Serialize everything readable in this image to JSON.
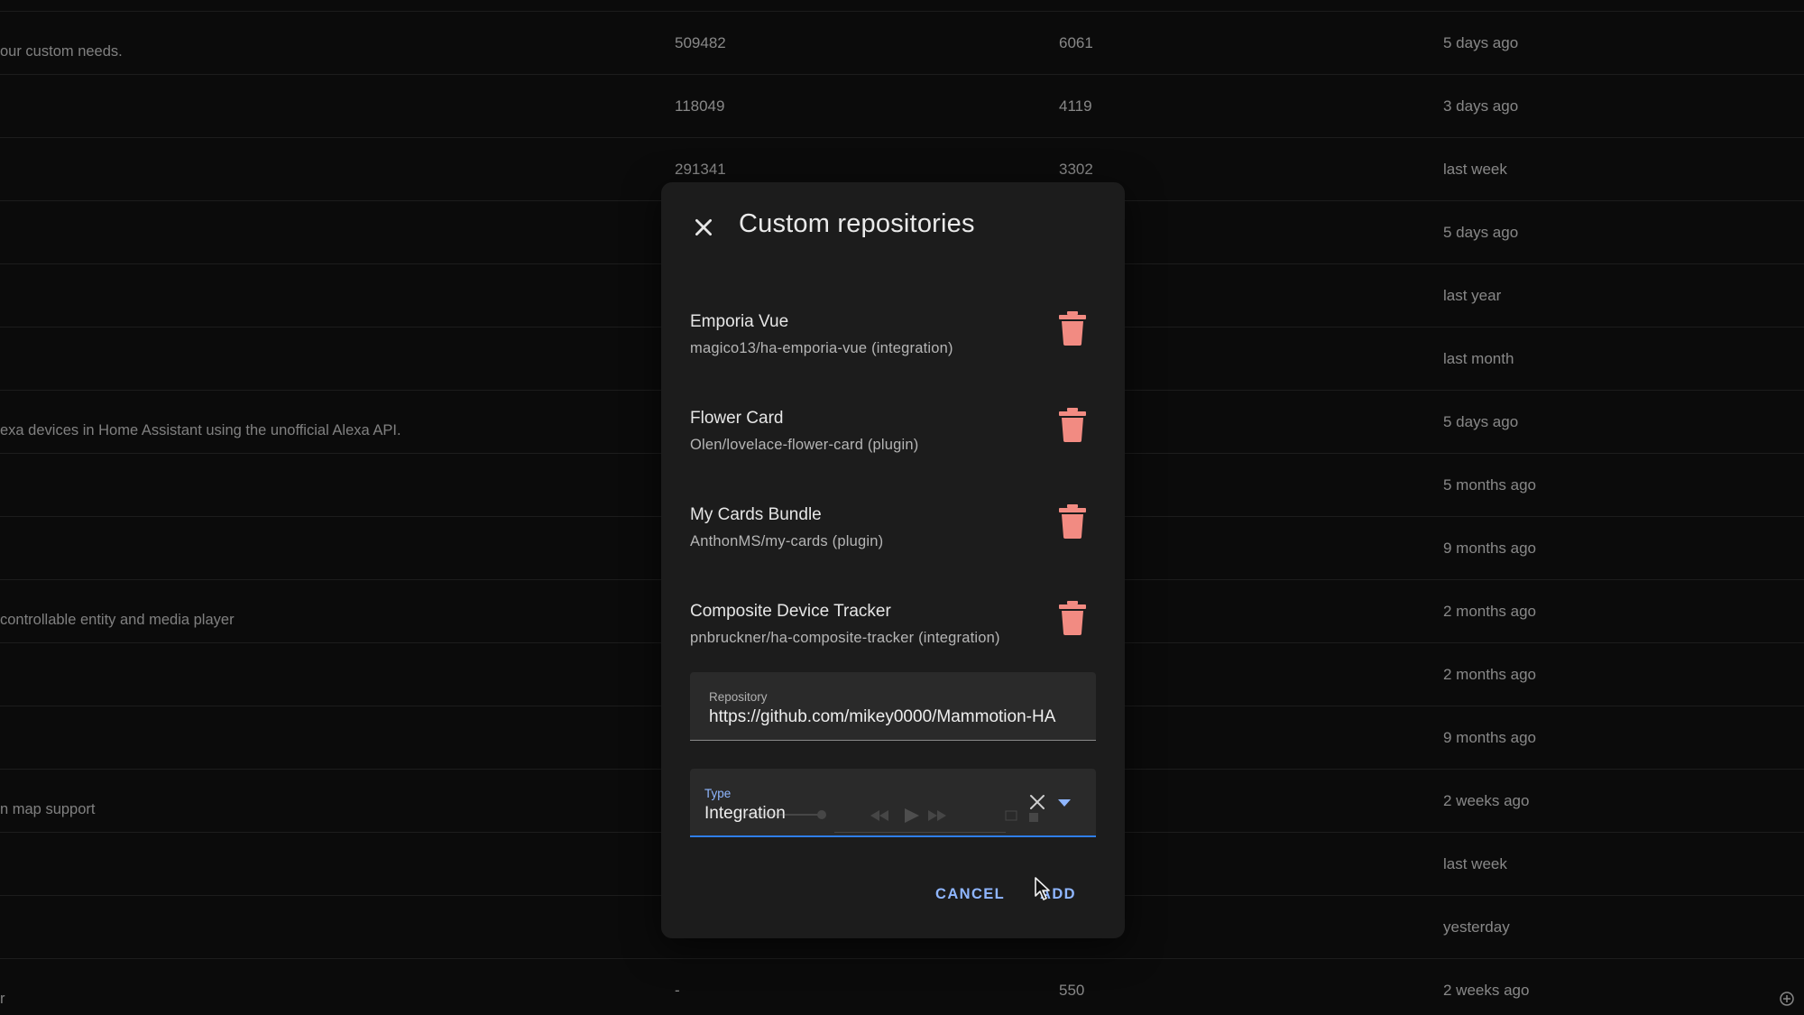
{
  "background_rows": [
    {
      "desc": "our custom needs.",
      "stars": "509482",
      "downloads": "6061",
      "updated": "5 days ago"
    },
    {
      "desc": "",
      "stars": "118049",
      "downloads": "4119",
      "updated": "3 days ago"
    },
    {
      "desc": "",
      "stars": "291341",
      "downloads": "3302",
      "updated": "last week"
    },
    {
      "desc": "",
      "stars": "",
      "downloads": "",
      "updated": "5 days ago"
    },
    {
      "desc": "",
      "stars": "",
      "downloads": "",
      "updated": "last year"
    },
    {
      "desc": "",
      "stars": "",
      "downloads": "",
      "updated": "last month"
    },
    {
      "desc": "exa devices in Home Assistant using the unofficial Alexa API.",
      "stars": "",
      "downloads": "",
      "updated": "5 days ago"
    },
    {
      "desc": "",
      "stars": "",
      "downloads": "",
      "updated": "5 months ago"
    },
    {
      "desc": "",
      "stars": "",
      "downloads": "",
      "updated": "9 months ago"
    },
    {
      "desc": "controllable entity and media player",
      "stars": "",
      "downloads": "",
      "updated": "2 months ago"
    },
    {
      "desc": "",
      "stars": "",
      "downloads": "",
      "updated": "2 months ago"
    },
    {
      "desc": "",
      "stars": "",
      "downloads": "",
      "updated": "9 months ago"
    },
    {
      "desc": "n map support",
      "stars": "",
      "downloads": "",
      "updated": "2 weeks ago"
    },
    {
      "desc": "",
      "stars": "",
      "downloads": "",
      "updated": "last week"
    },
    {
      "desc": "",
      "stars": "",
      "downloads": "",
      "updated": "yesterday"
    },
    {
      "desc": "r",
      "stars": "-",
      "downloads": "550",
      "updated": "2 weeks ago"
    }
  ],
  "dialog": {
    "title": "Custom repositories",
    "repositories": [
      {
        "name": "Emporia Vue",
        "sub": "magico13/ha-emporia-vue (integration)"
      },
      {
        "name": "Flower Card",
        "sub": "Olen/lovelace-flower-card (plugin)"
      },
      {
        "name": "My Cards Bundle",
        "sub": "AnthonMS/my-cards (plugin)"
      },
      {
        "name": "Composite Device Tracker",
        "sub": "pnbruckner/ha-composite-tracker (integration)"
      }
    ],
    "repository_field": {
      "label": "Repository",
      "value": "https://github.com/mikey0000/Mammotion-HA"
    },
    "type_field": {
      "label": "Type",
      "value": "Integration"
    },
    "cancel_label": "CANCEL",
    "add_label": "ADD"
  },
  "colors": {
    "accent": "#8fb6ff",
    "focus_underline": "#2f7ee8",
    "delete_icon": "#f28b82",
    "dialog_bg": "#1c1c1c",
    "page_bg": "#111111"
  },
  "icons": {
    "close": "close-icon",
    "delete": "trash-icon",
    "clear": "clear-icon",
    "dropdown": "caret-down-icon"
  }
}
